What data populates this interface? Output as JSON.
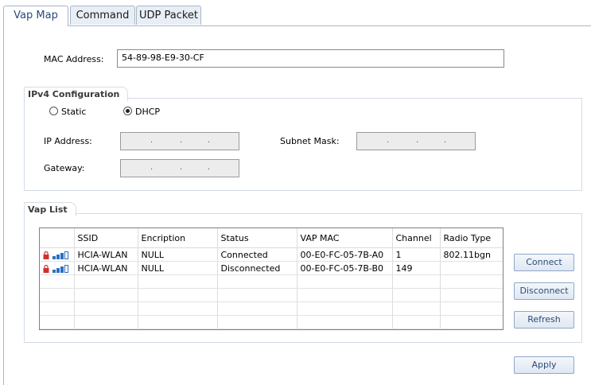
{
  "tabs": [
    {
      "label": "Vap Map"
    },
    {
      "label": "Command"
    },
    {
      "label": "UDP Packet"
    }
  ],
  "mac": {
    "label": "MAC Address:",
    "value": "54-89-98-E9-30-CF"
  },
  "ipv4": {
    "title": "IPv4 Configuration",
    "static_label": "Static",
    "dhcp_label": "DHCP",
    "selected": "DHCP",
    "ip_label": "IP Address:",
    "subnet_label": "Subnet Mask:",
    "gateway_label": "Gateway:"
  },
  "vap": {
    "title": "Vap List",
    "columns": [
      "SSID",
      "Encription",
      "Status",
      "VAP MAC",
      "Channel",
      "Radio Type"
    ],
    "rows": [
      {
        "ssid": "HCIA-WLAN",
        "encryption": "NULL",
        "status": "Connected",
        "mac": "00-E0-FC-05-7B-A0",
        "channel": "1",
        "radio": "802.11bgn"
      },
      {
        "ssid": "HCIA-WLAN",
        "encryption": "NULL",
        "status": "Disconnected",
        "mac": "00-E0-FC-05-7B-B0",
        "channel": "149",
        "radio": ""
      }
    ]
  },
  "buttons": {
    "connect": "Connect",
    "disconnect": "Disconnect",
    "refresh": "Refresh",
    "apply": "Apply"
  },
  "icons": {
    "lock_color": "#d0312d",
    "signal_color": "#2d6fc0"
  }
}
